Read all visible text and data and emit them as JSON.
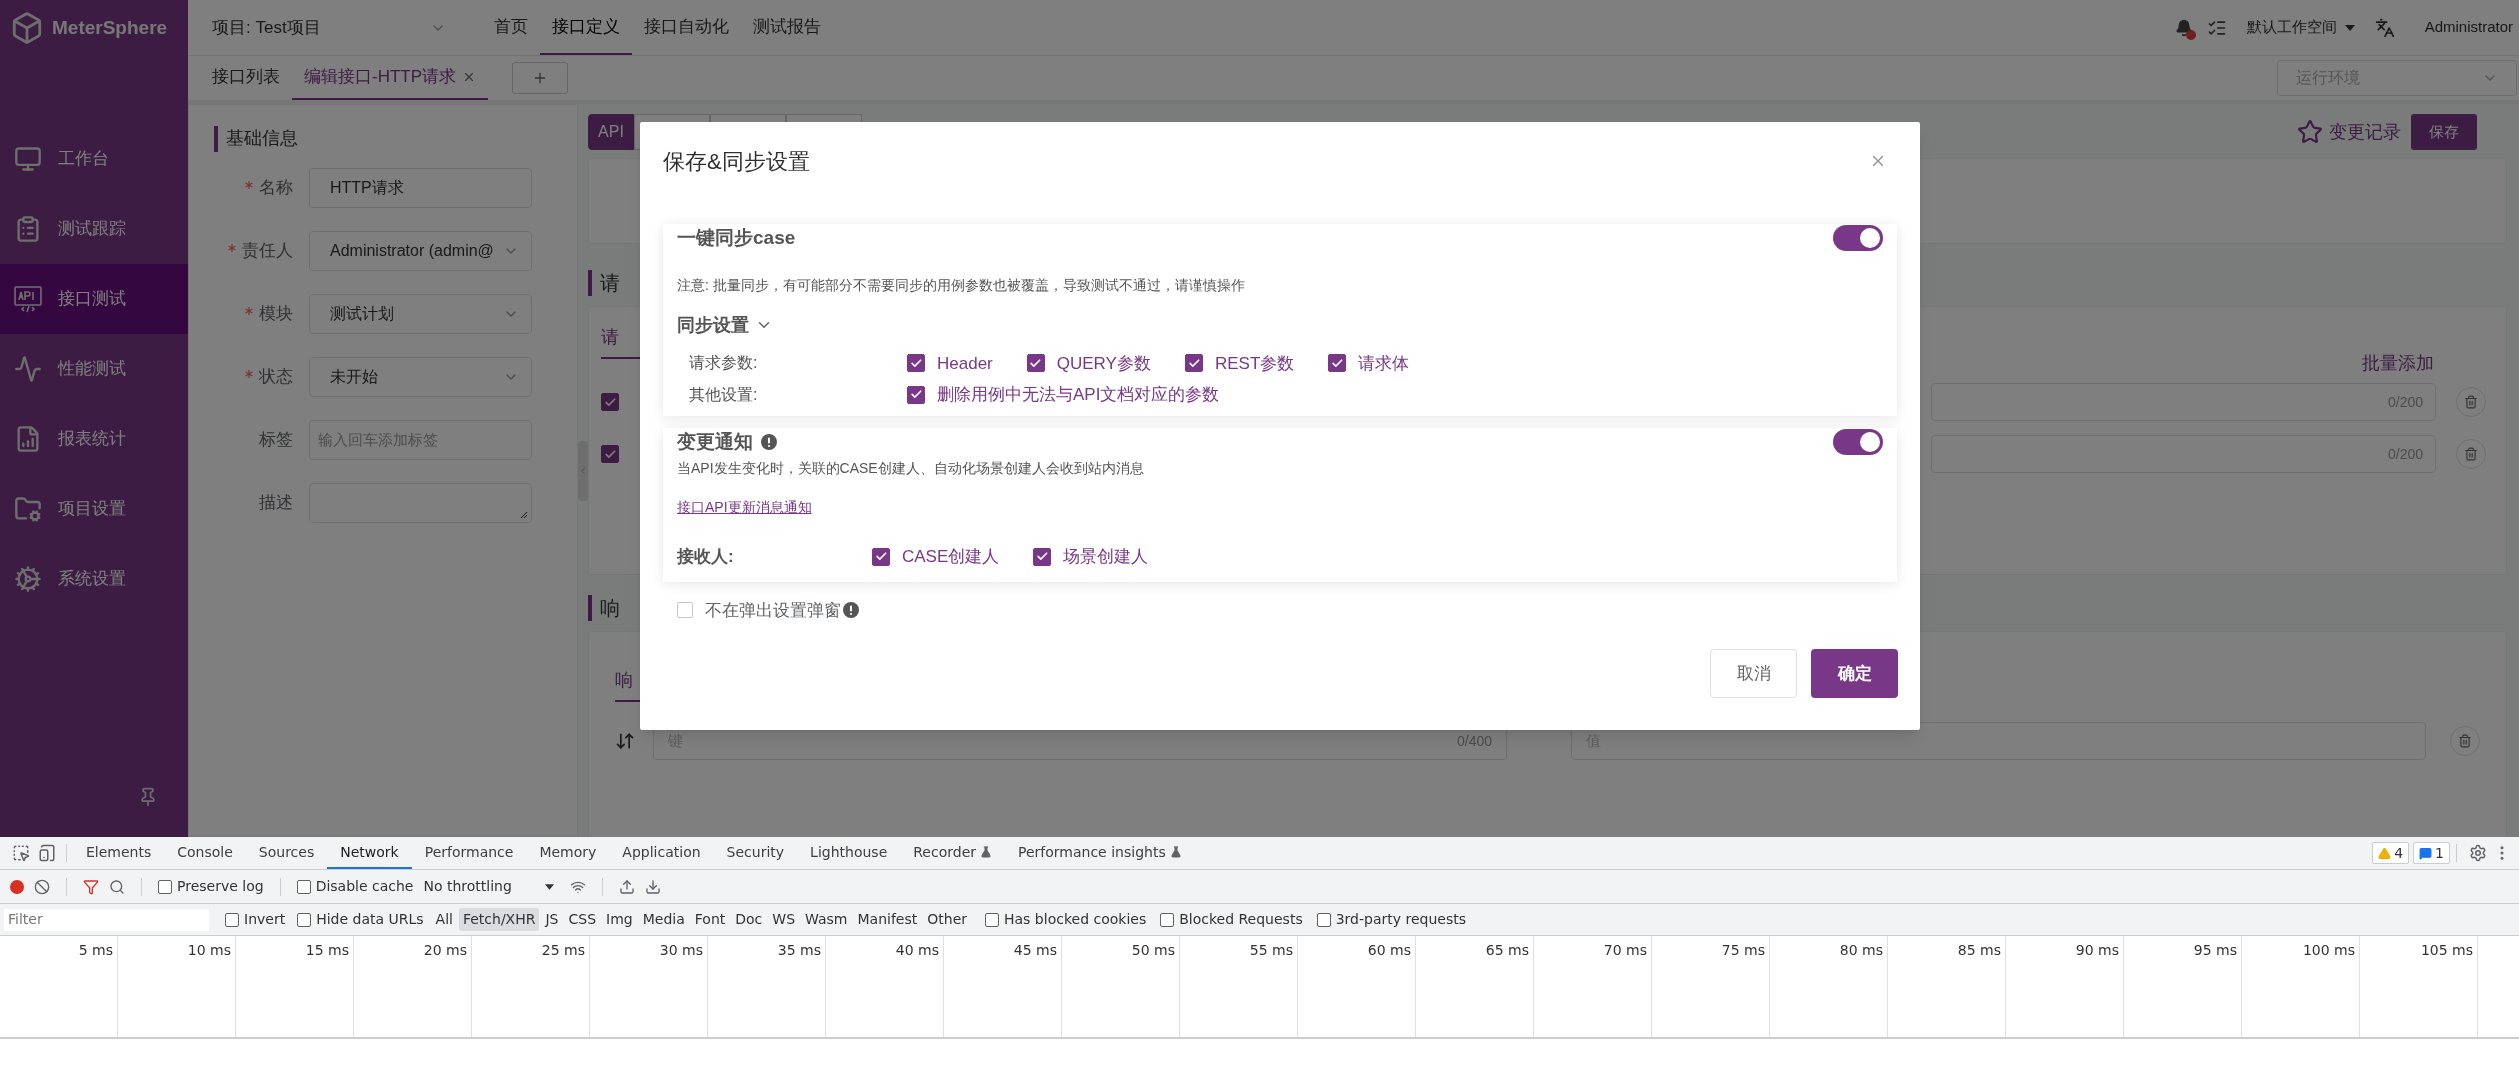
{
  "app": {
    "logo": "MeterSphere",
    "project": "项目: Test项目",
    "nav": [
      {
        "label": "首页",
        "selected": false
      },
      {
        "label": "接口定义",
        "selected": true
      },
      {
        "label": "接口自动化",
        "selected": false
      },
      {
        "label": "测试报告",
        "selected": false
      }
    ],
    "workspace": "默认工作空间",
    "user": "Administrator"
  },
  "sidebar": {
    "items": [
      {
        "label": "工作台",
        "selected": false
      },
      {
        "label": "测试跟踪",
        "selected": false
      },
      {
        "label": "接口测试",
        "selected": true
      },
      {
        "label": "性能测试",
        "selected": false
      },
      {
        "label": "报表统计",
        "selected": false
      },
      {
        "label": "项目设置",
        "selected": false
      },
      {
        "label": "系统设置",
        "selected": false
      }
    ]
  },
  "tabs": [
    {
      "label": "接口列表",
      "selected": false,
      "closable": false
    },
    {
      "label": "编辑接口-HTTP请求",
      "selected": true,
      "closable": true
    }
  ],
  "environment": {
    "placeholder": "运行环境"
  },
  "basic_info": {
    "title": "基础信息",
    "fields": [
      {
        "label": "名称",
        "required": true,
        "kind": "input",
        "value": "HTTP请求"
      },
      {
        "label": "责任人",
        "required": true,
        "kind": "select",
        "value": "Administrator (admin@"
      },
      {
        "label": "模块",
        "required": true,
        "kind": "select",
        "value": "测试计划"
      },
      {
        "label": "状态",
        "required": true,
        "kind": "select",
        "value": "未开始"
      },
      {
        "label": "标签",
        "required": false,
        "kind": "input",
        "placeholder": "输入回车添加标签"
      },
      {
        "label": "描述",
        "required": false,
        "kind": "textarea"
      }
    ]
  },
  "editor": {
    "tabs": [
      {
        "label": "API",
        "selected": true
      },
      {
        "selected": false
      },
      {
        "selected": false
      },
      {
        "selected": false
      }
    ],
    "change_log": "变更记录",
    "save": "保存",
    "request": {
      "title": "请",
      "tab": "请",
      "batch_add": "批量添加",
      "rows": [
        {
          "checked": true,
          "count": "0/200"
        },
        {
          "checked": true,
          "count": "0/200"
        }
      ]
    },
    "response": {
      "title": "响",
      "tab": "响",
      "row": {
        "key_placeholder": "键",
        "key_count": "0/400",
        "value_placeholder": "值"
      }
    }
  },
  "dialog": {
    "title": "保存&同步设置",
    "sync": {
      "title": "一键同步case",
      "on": true,
      "note": "注意: 批量同步，有可能部分不需要同步的用例参数也被覆盖，导致测试不通过，请谨慎操作",
      "settings_title": "同步设置",
      "expanded": true,
      "groups": [
        {
          "label": "请求参数:",
          "options": [
            {
              "label": "Header",
              "checked": true
            },
            {
              "label": "QUERY参数",
              "checked": true
            },
            {
              "label": "REST参数",
              "checked": true
            },
            {
              "label": "请求体",
              "checked": true
            }
          ]
        },
        {
          "label": "其他设置:",
          "options": [
            {
              "label": "删除用例中无法与API文档对应的参数",
              "checked": true
            }
          ]
        }
      ]
    },
    "notify": {
      "title": "变更通知",
      "on": true,
      "description": "当API发生变化时，关联的CASE创建人、自动化场景创建人会收到站内消息",
      "link": "接口API更新消息通知",
      "receivers_label": "接收人:",
      "receivers": [
        {
          "label": "CASE创建人",
          "checked": true
        },
        {
          "label": "场景创建人",
          "checked": true
        }
      ]
    },
    "dont_show": {
      "label": "不在弹出设置弹窗",
      "checked": false
    },
    "buttons": [
      {
        "label": "取消",
        "kind": "secondary"
      },
      {
        "label": "确定",
        "kind": "primary"
      }
    ]
  },
  "devtools": {
    "tabs": [
      {
        "label": "Elements",
        "selected": false,
        "experimental": false
      },
      {
        "label": "Console",
        "selected": false,
        "experimental": false
      },
      {
        "label": "Sources",
        "selected": false,
        "experimental": false
      },
      {
        "label": "Network",
        "selected": true,
        "experimental": false
      },
      {
        "label": "Performance",
        "selected": false,
        "experimental": false
      },
      {
        "label": "Memory",
        "selected": false,
        "experimental": false
      },
      {
        "label": "Application",
        "selected": false,
        "experimental": false
      },
      {
        "label": "Security",
        "selected": false,
        "experimental": false
      },
      {
        "label": "Lighthouse",
        "selected": false,
        "experimental": false
      },
      {
        "label": "Recorder",
        "selected": false,
        "experimental": true
      },
      {
        "label": "Performance insights",
        "selected": false,
        "experimental": true
      }
    ],
    "warnings": "4",
    "messages": "1",
    "preserve_log": {
      "label": "Preserve log",
      "checked": false
    },
    "disable_cache": {
      "label": "Disable cache",
      "checked": false
    },
    "throttling": "No throttling",
    "filter": {
      "placeholder": "Filter"
    },
    "invert": {
      "label": "Invert",
      "checked": false
    },
    "hide_data_urls": {
      "label": "Hide data URLs",
      "checked": false
    },
    "types": [
      {
        "label": "All",
        "selected": false
      },
      {
        "label": "Fetch/XHR",
        "selected": true
      },
      {
        "label": "JS",
        "selected": false
      },
      {
        "label": "CSS",
        "selected": false
      },
      {
        "label": "Img",
        "selected": false
      },
      {
        "label": "Media",
        "selected": false
      },
      {
        "label": "Font",
        "selected": false
      },
      {
        "label": "Doc",
        "selected": false
      },
      {
        "label": "WS",
        "selected": false
      },
      {
        "label": "Wasm",
        "selected": false
      },
      {
        "label": "Manifest",
        "selected": false
      },
      {
        "label": "Other",
        "selected": false
      }
    ],
    "extra_filters": [
      {
        "label": "Has blocked cookies",
        "checked": false
      },
      {
        "label": "Blocked Requests",
        "checked": false
      },
      {
        "label": "3rd-party requests",
        "checked": false
      }
    ],
    "ticks": [
      "5 ms",
      "10 ms",
      "15 ms",
      "20 ms",
      "25 ms",
      "30 ms",
      "35 ms",
      "40 ms",
      "45 ms",
      "50 ms",
      "55 ms",
      "60 ms",
      "65 ms",
      "70 ms",
      "75 ms",
      "80 ms",
      "85 ms",
      "90 ms",
      "95 ms",
      "100 ms",
      "105 ms"
    ]
  }
}
